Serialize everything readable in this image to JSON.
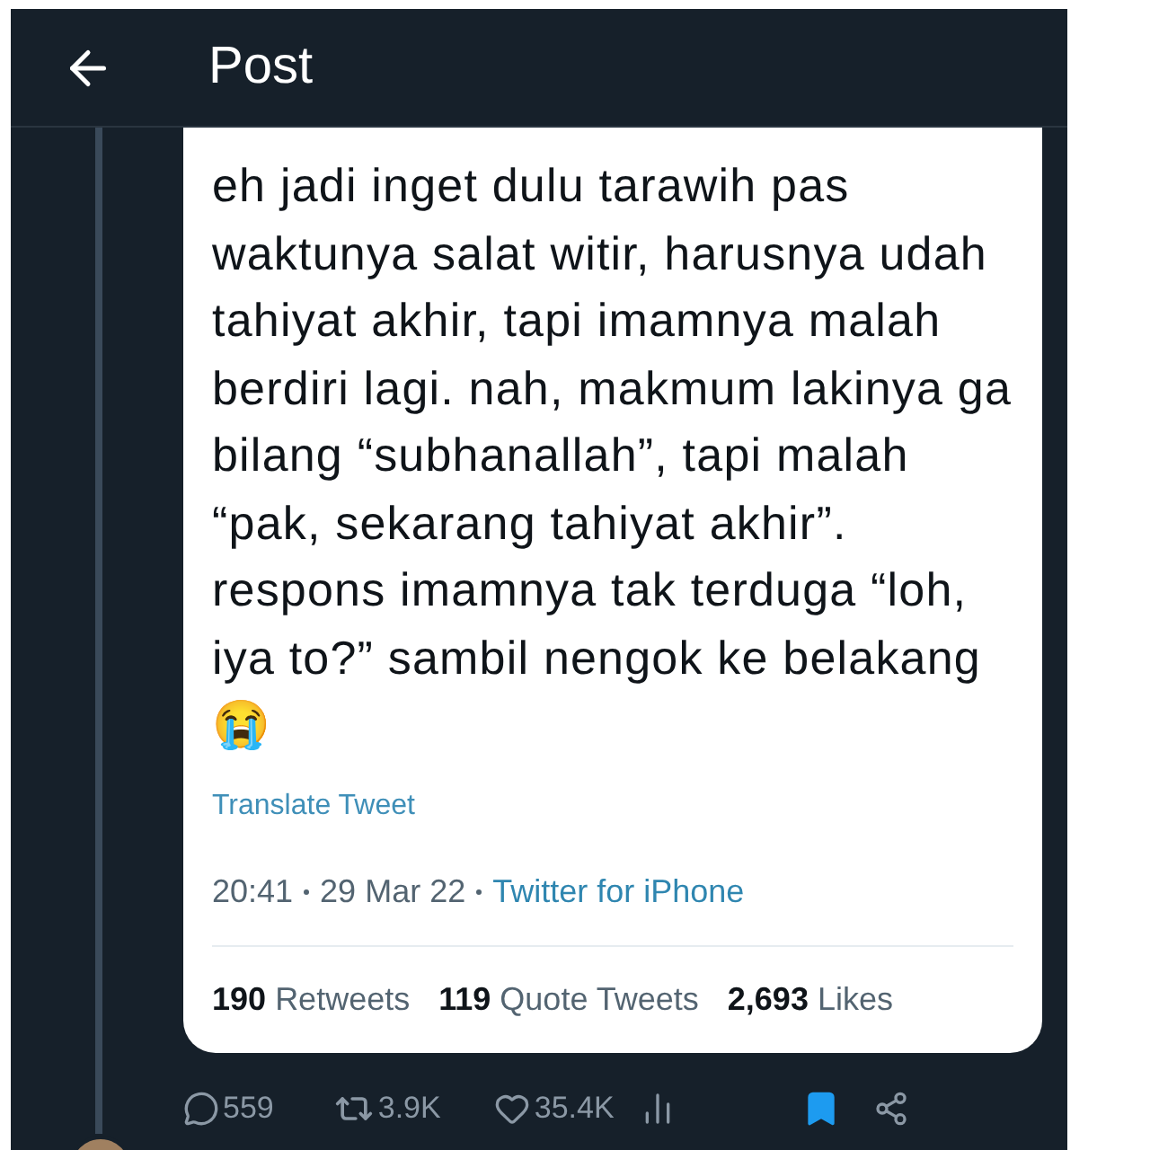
{
  "header": {
    "title": "Post"
  },
  "tweet": {
    "text": "eh jadi inget dulu tarawih pas waktunya salat witir, harusnya udah tahiyat akhir, tapi imamnya malah berdiri lagi. nah, makmum lakinya ga bilang “subhanallah”, tapi malah “pak, sekarang tahiyat akhir”. respons imamnya tak terduga “loh, iya to?” sambil nengok ke belakang😭",
    "translate": "Translate Tweet",
    "time": "20:41",
    "date": "29 Mar 22",
    "source": "Twitter for iPhone",
    "stats": [
      {
        "count": "190",
        "label": "Retweets"
      },
      {
        "count": "119",
        "label": "Quote Tweets"
      },
      {
        "count": "2,693",
        "label": "Likes"
      }
    ]
  },
  "actions": {
    "replies": "559",
    "retweets": "3.9K",
    "likes": "35.4K",
    "bookmarked": true
  }
}
